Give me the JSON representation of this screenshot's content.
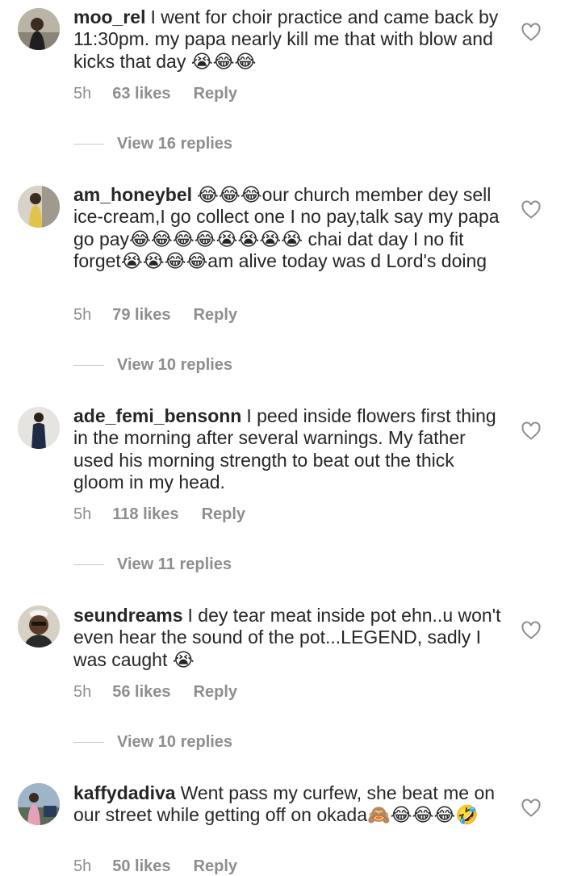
{
  "comments": [
    {
      "username": "moo_rel",
      "text": "I went for choir practice and came back by 11:30pm. my papa nearly kill me that with blow and kicks that day 😭😂😂",
      "time": "5h",
      "likes": "63 likes",
      "reply": "Reply",
      "view_replies": "View 16 replies"
    },
    {
      "username": "am_honeybel",
      "text": "😂😂😂our church member dey sell ice-cream,I go collect one I no pay,talk say my papa go pay😂😂😂😂😭😭😭😭 chai dat day I no fit forget😭😭😂😂am alive today was d Lord's doing",
      "time": "5h",
      "likes": "79 likes",
      "reply": "Reply",
      "view_replies": "View 10 replies"
    },
    {
      "username": "ade_femi_bensonn",
      "text": "I peed inside flowers first thing in the morning after several warnings. My father used his morning strength to beat out the thick gloom in my head.",
      "time": "5h",
      "likes": "118 likes",
      "reply": "Reply",
      "view_replies": "View 11 replies"
    },
    {
      "username": "seundreams",
      "text": "I dey tear meat inside pot ehn..u won't even hear the sound of the pot...LEGEND, sadly I was caught 😭",
      "time": "5h",
      "likes": "56 likes",
      "reply": "Reply",
      "view_replies": "View 10 replies"
    },
    {
      "username": "kaffydadiva",
      "text": "Went pass my curfew, she beat me on our street while getting off on okada🙈😂😂😂🤣",
      "time": "5h",
      "likes": "50 likes",
      "reply": "Reply"
    }
  ],
  "icons": {
    "like": "heart-outline-icon"
  },
  "colors": {
    "text": "#262626",
    "muted": "#8e8e8e",
    "background": "#ffffff"
  }
}
